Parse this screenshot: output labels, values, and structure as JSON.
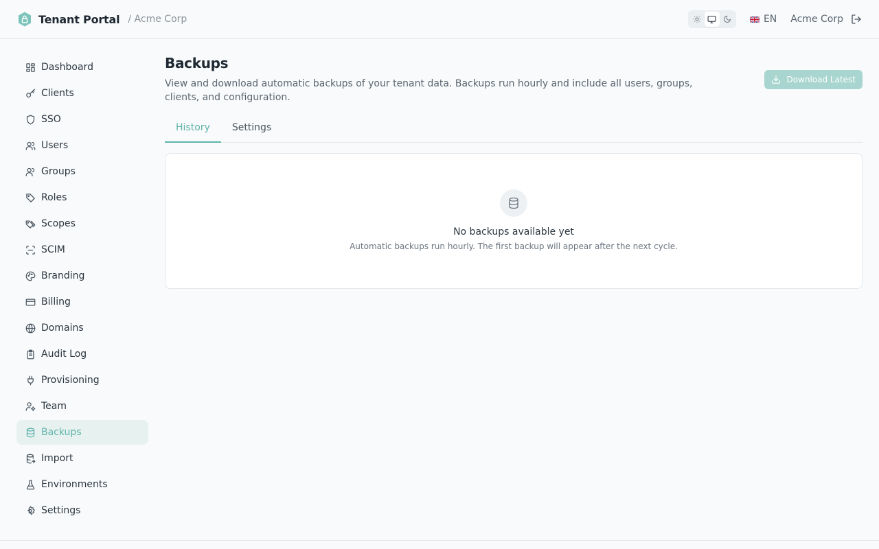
{
  "header": {
    "brand_title": "Tenant Portal",
    "breadcrumb": "/ Acme Corp",
    "language": "EN",
    "tenant_name": "Acme Corp",
    "theme_options": [
      "light",
      "system",
      "dark"
    ],
    "theme_selected": "system"
  },
  "sidebar": {
    "items": [
      {
        "label": "Dashboard",
        "icon": "dashboard-icon"
      },
      {
        "label": "Clients",
        "icon": "key-icon"
      },
      {
        "label": "SSO",
        "icon": "shield-icon"
      },
      {
        "label": "Users",
        "icon": "users-icon"
      },
      {
        "label": "Groups",
        "icon": "groups-icon"
      },
      {
        "label": "Roles",
        "icon": "tag-icon"
      },
      {
        "label": "Scopes",
        "icon": "tags-icon"
      },
      {
        "label": "SCIM",
        "icon": "scan-icon"
      },
      {
        "label": "Branding",
        "icon": "palette-icon"
      },
      {
        "label": "Billing",
        "icon": "credit-card-icon"
      },
      {
        "label": "Domains",
        "icon": "globe-icon"
      },
      {
        "label": "Audit Log",
        "icon": "clipboard-icon"
      },
      {
        "label": "Provisioning",
        "icon": "plug-icon"
      },
      {
        "label": "Team",
        "icon": "user-cog-icon"
      },
      {
        "label": "Backups",
        "icon": "database-icon",
        "active": true
      },
      {
        "label": "Import",
        "icon": "database-import-icon"
      },
      {
        "label": "Environments",
        "icon": "flask-icon"
      },
      {
        "label": "Settings",
        "icon": "gear-icon"
      }
    ]
  },
  "main": {
    "title": "Backups",
    "description": "View and download automatic backups of your tenant data. Backups run hourly and include all users, groups, clients, and configuration.",
    "download_label": "Download Latest",
    "tabs": [
      {
        "label": "History",
        "active": true
      },
      {
        "label": "Settings",
        "active": false
      }
    ],
    "empty_title": "No backups available yet",
    "empty_subtitle": "Automatic backups run hourly. The first backup will appear after the next cycle."
  },
  "colors": {
    "accent": "#5fb3aa",
    "accent_bg": "#e6f1f0",
    "button_disabled": "#a8d5cf"
  }
}
